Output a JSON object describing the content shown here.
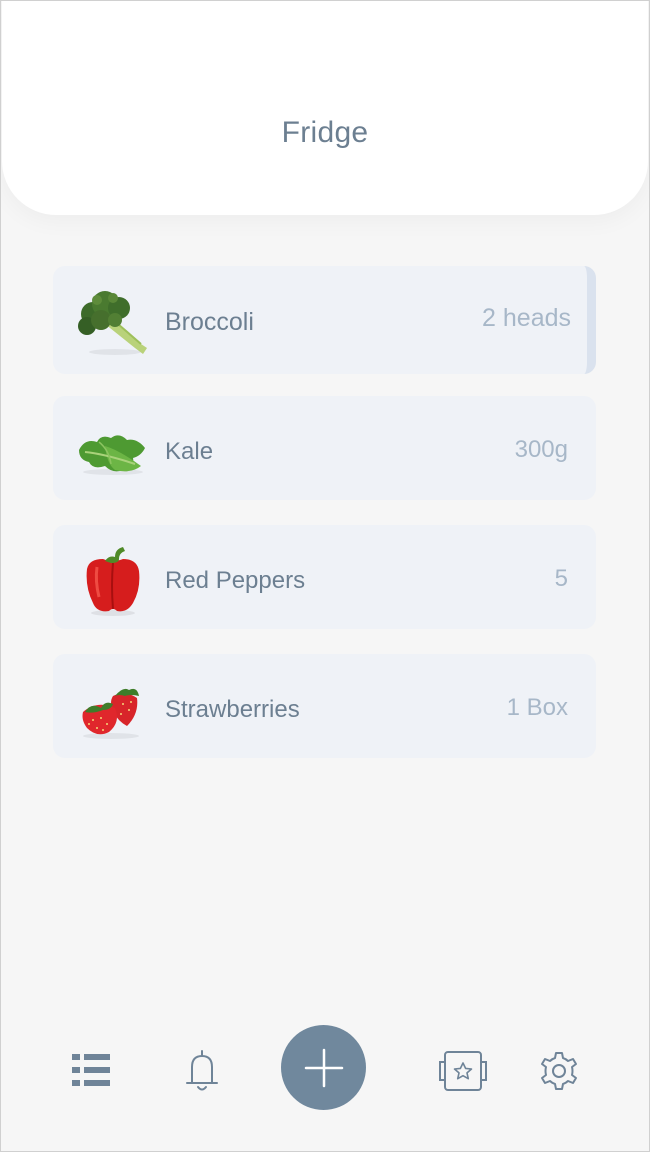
{
  "header": {
    "title": "Fridge"
  },
  "items": [
    {
      "name": "Broccoli",
      "quantity": "2 heads",
      "icon": "broccoli-icon"
    },
    {
      "name": "Kale",
      "quantity": "300g",
      "icon": "kale-icon"
    },
    {
      "name": "Red Peppers",
      "quantity": "5",
      "icon": "red-pepper-icon"
    },
    {
      "name": "Strawberries",
      "quantity": "1 Box",
      "icon": "strawberry-icon"
    }
  ],
  "nav": {
    "items": [
      "list-icon",
      "bell-icon",
      "plus-icon",
      "starred-box-icon",
      "gear-icon"
    ]
  },
  "colors": {
    "accent": "#70889d",
    "text": "#6c7f91",
    "quantity_text": "#a7b7c8",
    "card_bg": "#eff2f7",
    "icon_stroke": "#6f8498"
  }
}
